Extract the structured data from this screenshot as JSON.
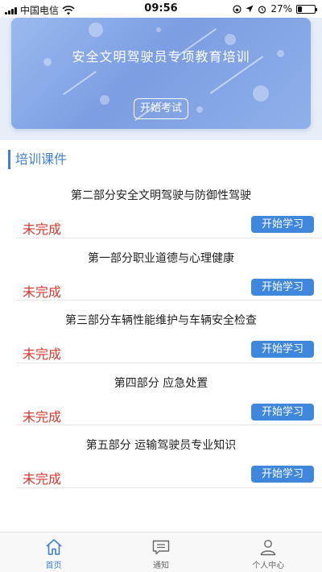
{
  "status_bar": {
    "carrier": "中国电信",
    "time": "09:56",
    "battery": "27%",
    "battery_level": 0.27
  },
  "banner": {
    "title": "安全文明驾驶员专项教育培训",
    "start_exam_label": "开始考试"
  },
  "section": {
    "title": "培训课件"
  },
  "courses": [
    {
      "title": "第二部分安全文明驾驶与防御性驾驶",
      "status": "未完成",
      "action": "开始学习"
    },
    {
      "title": "第一部分职业道德与心理健康",
      "status": "未完成",
      "action": "开始学习"
    },
    {
      "title": "第三部分车辆性能维护与车辆安全检查",
      "status": "未完成",
      "action": "开始学习"
    },
    {
      "title": "第四部分 应急处置",
      "status": "未完成",
      "action": "开始学习"
    },
    {
      "title": "第五部分 运输驾驶员专业知识",
      "status": "未完成",
      "action": "开始学习"
    }
  ],
  "tab_bar": {
    "items": [
      {
        "label": "首页",
        "icon": "home-icon",
        "active": true
      },
      {
        "label": "通知",
        "icon": "message-icon",
        "active": false
      },
      {
        "label": "个人中心",
        "icon": "person-icon",
        "active": false
      }
    ]
  },
  "colors": {
    "accent": "#3f7fd6",
    "status_incomplete": "#d9362b",
    "button": "#3f87dd"
  }
}
